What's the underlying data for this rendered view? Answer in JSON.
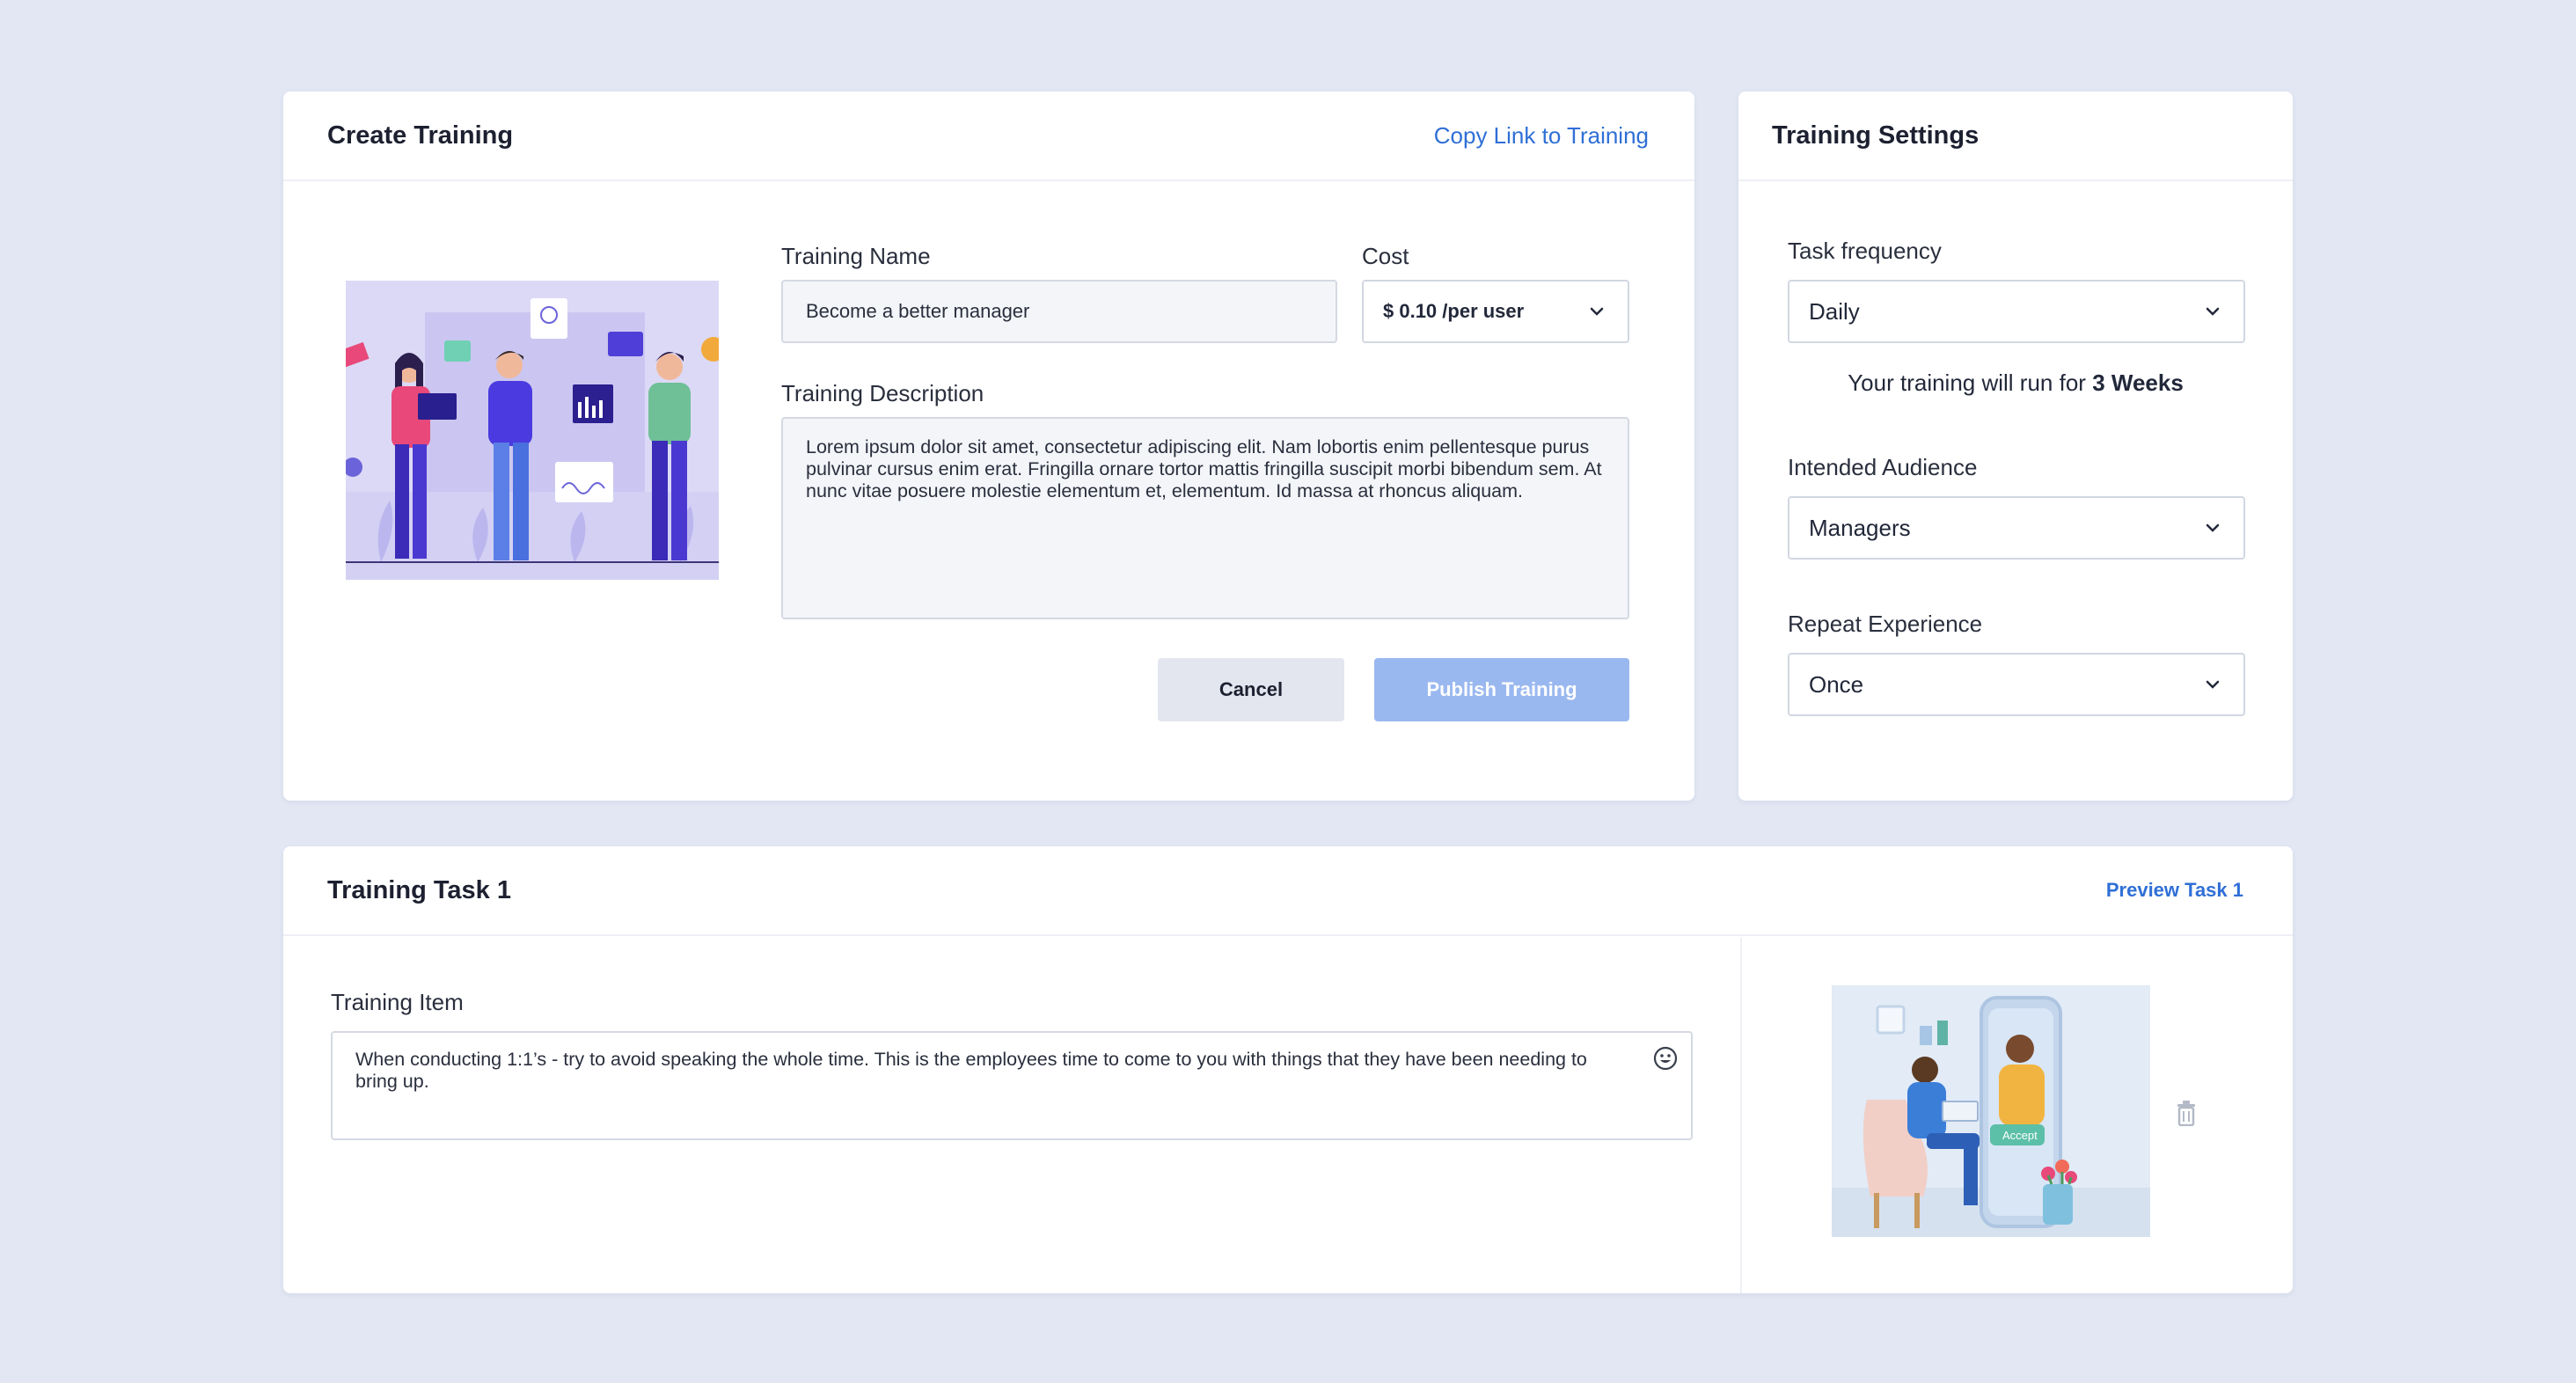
{
  "create_training": {
    "title": "Create Training",
    "copy_link": "Copy Link to Training",
    "name_label": "Training Name",
    "name_value": "Become a better manager",
    "cost_label": "Cost",
    "cost_value": "$ 0.10 /per user",
    "description_label": "Training Description",
    "description_value": "Lorem ipsum dolor sit amet, consectetur adipiscing elit. Nam lobortis enim pellentesque purus pulvinar cursus enim erat. Fringilla ornare tortor mattis fringilla suscipit morbi bibendum sem. At nunc vitae posuere molestie elementum et, elementum. Id massa at rhoncus aliquam.",
    "cancel_label": "Cancel",
    "publish_label": "Publish Training"
  },
  "training_settings": {
    "title": "Training Settings",
    "frequency_label": "Task frequency",
    "frequency_value": "Daily",
    "duration_prefix": "Your training will run for",
    "duration_value": "3 Weeks",
    "audience_label": "Intended Audience",
    "audience_value": "Managers",
    "repeat_label": "Repeat Experience",
    "repeat_value": "Once"
  },
  "training_task": {
    "title": "Training Task 1",
    "preview_link": "Preview Task 1",
    "item_label": "Training Item",
    "item_value": "When conducting 1:1’s - try to avoid speaking the whole time. This is the employees time to come to you with things that they have been needing to bring up.",
    "illustration_badge": "Accept"
  },
  "colors": {
    "background": "#e2e7f3",
    "accent_link": "#2f6fd6",
    "publish_button_disabled": "#9ab8f0",
    "cancel_button": "#e3e6ee"
  },
  "icons": {
    "chevron": "chevron-down-icon",
    "emoji": "smiley-icon",
    "delete": "trash-icon"
  }
}
